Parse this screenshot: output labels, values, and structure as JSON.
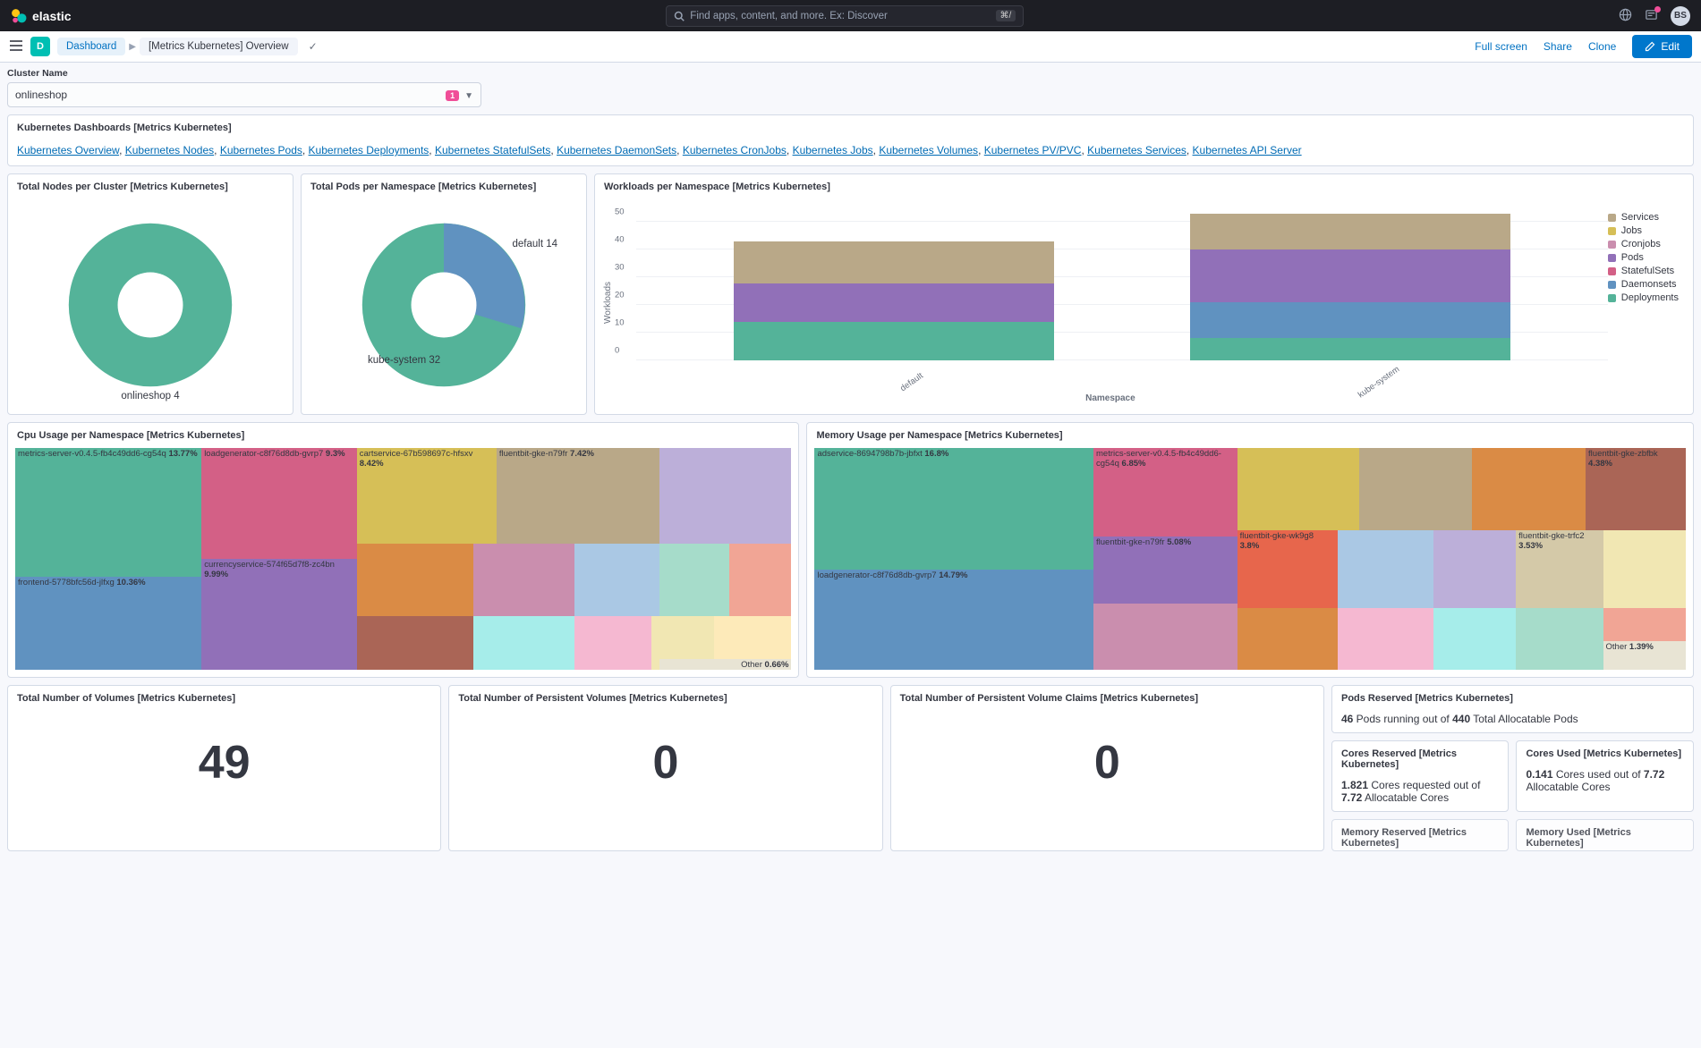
{
  "header": {
    "brand": "elastic",
    "search_placeholder": "Find apps, content, and more. Ex: Discover",
    "search_kbd": "⌘/",
    "avatar_initials": "BS"
  },
  "breadcrumb": {
    "app_letter": "D",
    "items": [
      "Dashboard",
      "[Metrics Kubernetes] Overview"
    ]
  },
  "actions": {
    "fullscreen": "Full screen",
    "share": "Share",
    "clone": "Clone",
    "edit": "Edit"
  },
  "filter": {
    "label": "Cluster Name",
    "value": "onlineshop",
    "badge": "1"
  },
  "dash_links": {
    "title": "Kubernetes Dashboards [Metrics Kubernetes]",
    "items": [
      "Kubernetes Overview",
      "Kubernetes Nodes",
      "Kubernetes Pods",
      "Kubernetes Deployments",
      "Kubernetes StatefulSets",
      "Kubernetes DaemonSets",
      "Kubernetes CronJobs",
      "Kubernetes Jobs",
      "Kubernetes Volumes",
      "Kubernetes PV/PVC",
      "Kubernetes Services",
      "Kubernetes API Server"
    ]
  },
  "panels": {
    "nodes_title": "Total Nodes per Cluster [Metrics Kubernetes]",
    "nodes_label": "onlineshop 4",
    "pods_title": "Total Pods per Namespace [Metrics Kubernetes]",
    "pods_default": "default 14",
    "pods_kube": "kube-system 32",
    "workloads_title": "Workloads per Namespace [Metrics Kubernetes]",
    "workloads_y": "Workloads",
    "workloads_x": "Namespace",
    "workloads_legend": [
      "Services",
      "Jobs",
      "Cronjobs",
      "Pods",
      "StatefulSets",
      "Daemonsets",
      "Deployments"
    ],
    "workloads_cat_0": "default",
    "workloads_cat_1": "kube-system",
    "cpu_title": "Cpu Usage per Namespace [Metrics Kubernetes]",
    "mem_title": "Memory Usage per Namespace [Metrics Kubernetes]",
    "vol_title": "Total Number of Volumes [Metrics Kubernetes]",
    "vol_value": "49",
    "pv_title": "Total Number of Persistent Volumes [Metrics Kubernetes]",
    "pv_value": "0",
    "pvc_title": "Total Number of Persistent Volume Claims [Metrics Kubernetes]",
    "pvc_value": "0",
    "pods_res_title": "Pods Reserved [Metrics Kubernetes]",
    "pods_res_a": "46",
    "pods_res_b": " Pods running out of ",
    "pods_res_c": "440",
    "pods_res_d": " Total Allocatable Pods",
    "cores_res_title": "Cores Reserved [Metrics Kubernetes]",
    "cores_res_a": "1.821",
    "cores_res_b": " Cores requested out of ",
    "cores_res_c": "7.72",
    "cores_res_d": " Allocatable Cores",
    "cores_used_title": "Cores Used [Metrics Kubernetes]",
    "cores_used_a": "0.141",
    "cores_used_b": " Cores used out of ",
    "cores_used_c": "7.72",
    "cores_used_d": " Allocatable Cores",
    "mem_res_title": "Memory Reserved [Metrics Kubernetes]",
    "mem_used_title": "Memory Used [Metrics Kubernetes]"
  },
  "chart_data": {
    "nodes_donut": {
      "type": "pie",
      "series": [
        {
          "name": "onlineshop",
          "value": 4
        }
      ]
    },
    "pods_donut": {
      "type": "pie",
      "series": [
        {
          "name": "default",
          "value": 14
        },
        {
          "name": "kube-system",
          "value": 32
        }
      ]
    },
    "workloads_bar": {
      "type": "bar_stacked",
      "ylabel": "Workloads",
      "xlabel": "Namespace",
      "ylim": [
        0,
        55
      ],
      "yticks": [
        0,
        10,
        20,
        30,
        40,
        50
      ],
      "categories": [
        "default",
        "kube-system"
      ],
      "series": [
        {
          "name": "Deployments",
          "color": "#54b399",
          "values": [
            14,
            8
          ]
        },
        {
          "name": "Daemonsets",
          "color": "#6092c0",
          "values": [
            0,
            13
          ]
        },
        {
          "name": "StatefulSets",
          "color": "#d36086",
          "values": [
            0,
            0
          ]
        },
        {
          "name": "Pods",
          "color": "#9170b8",
          "values": [
            14,
            19
          ]
        },
        {
          "name": "Cronjobs",
          "color": "#ca8eae",
          "values": [
            0,
            0
          ]
        },
        {
          "name": "Jobs",
          "color": "#d6bf57",
          "values": [
            0,
            0
          ]
        },
        {
          "name": "Services",
          "color": "#b9a888",
          "values": [
            15,
            13
          ]
        }
      ]
    },
    "cpu_treemap": {
      "type": "treemap",
      "items": [
        {
          "label": "metrics-server-v0.4.5-fb4c49dd6-cg54q",
          "pct": 13.77,
          "color": "#54b399"
        },
        {
          "label": "frontend-5778bfc56d-jlfxg",
          "pct": 10.36,
          "color": "#6092c0"
        },
        {
          "label": "currencyservice-574f65d7f8-zc4bn",
          "pct": 9.99,
          "color": "#9170b8"
        },
        {
          "label": "loadgenerator-c8f76d8db-gvrp7",
          "pct": 9.3,
          "color": "#d36086"
        },
        {
          "label": "cartservice-67b598697c-hfsxv",
          "pct": 8.42,
          "color": "#d6bf57"
        },
        {
          "label": "fluentbit-gke-n79fr",
          "pct": 7.42,
          "color": "#b9a888"
        },
        {
          "label": "",
          "pct": 6.2,
          "color": "#da8b45"
        },
        {
          "label": "",
          "pct": 5.8,
          "color": "#ca8eae"
        },
        {
          "label": "",
          "pct": 5.4,
          "color": "#bcafd9"
        },
        {
          "label": "",
          "pct": 4.8,
          "color": "#aac8e4"
        },
        {
          "label": "",
          "pct": 4.3,
          "color": "#aa6556"
        },
        {
          "label": "",
          "pct": 3.9,
          "color": "#a6edea"
        },
        {
          "label": "",
          "pct": 3.3,
          "color": "#f5b8d1"
        },
        {
          "label": "",
          "pct": 2.8,
          "color": "#fdeab9"
        },
        {
          "label": "",
          "pct": 2.3,
          "color": "#f1a595"
        },
        {
          "label": "",
          "pct": 1.9,
          "color": "#a6dcca"
        },
        {
          "label": "Other",
          "pct": 0.66,
          "color": "#f1e7b3"
        }
      ]
    },
    "mem_treemap": {
      "type": "treemap",
      "items": [
        {
          "label": "adservice-8694798b7b-jbfxt",
          "pct": 16.8,
          "color": "#54b399"
        },
        {
          "label": "loadgenerator-c8f76d8db-gvrp7",
          "pct": 14.79,
          "color": "#6092c0"
        },
        {
          "label": "metrics-server-v0.4.5-fb4c49dd6-cg54q",
          "pct": 6.85,
          "color": "#d36086"
        },
        {
          "label": "fluentbit-gke-n79fr",
          "pct": 5.08,
          "color": "#9170b8"
        },
        {
          "label": "fluentbit-gke-zbfbk",
          "pct": 4.38,
          "color": "#aa6556"
        },
        {
          "label": "fluentbit-gke-wk9g8",
          "pct": 3.8,
          "color": "#e7664c"
        },
        {
          "label": "fluentbit-gke-trfc2",
          "pct": 3.53,
          "color": "#d4c9a8"
        },
        {
          "label": "Other",
          "pct": 1.39,
          "color": "#f1e7b3"
        }
      ]
    }
  },
  "cpu_labels": {
    "a": "metrics-server-v0.4.5-fb4c49dd6-cg54q",
    "a_v": "13.77%",
    "b": "frontend-5778bfc56d-jlfxg",
    "b_v": "10.36%",
    "c": "currencyservice-574f65d7f8-zc4bn",
    "c_v": "9.99%",
    "d": "loadgenerator-c8f76d8db-gvrp7",
    "d_v": "9.3%",
    "e": "cartservice-67b598697c-hfsxv",
    "e_v": "8.42%",
    "f": "fluentbit-gke-n79fr",
    "f_v": "7.42%",
    "other": "Other",
    "other_v": "0.66%"
  },
  "mem_labels": {
    "a": "adservice-8694798b7b-jbfxt",
    "a_v": "16.8%",
    "b": "loadgenerator-c8f76d8db-gvrp7",
    "b_v": "14.79%",
    "c": "metrics-server-v0.4.5-fb4c49dd6-cg54q",
    "c_v": "6.85%",
    "d": "fluentbit-gke-n79fr",
    "d_v": "5.08%",
    "e": "fluentbit-gke-zbfbk",
    "e_v": "4.38%",
    "f": "fluentbit-gke-wk9g8",
    "f_v": "3.8%",
    "g": "fluentbit-gke-trfc2",
    "g_v": "3.53%",
    "other": "Other",
    "other_v": "1.39%"
  }
}
